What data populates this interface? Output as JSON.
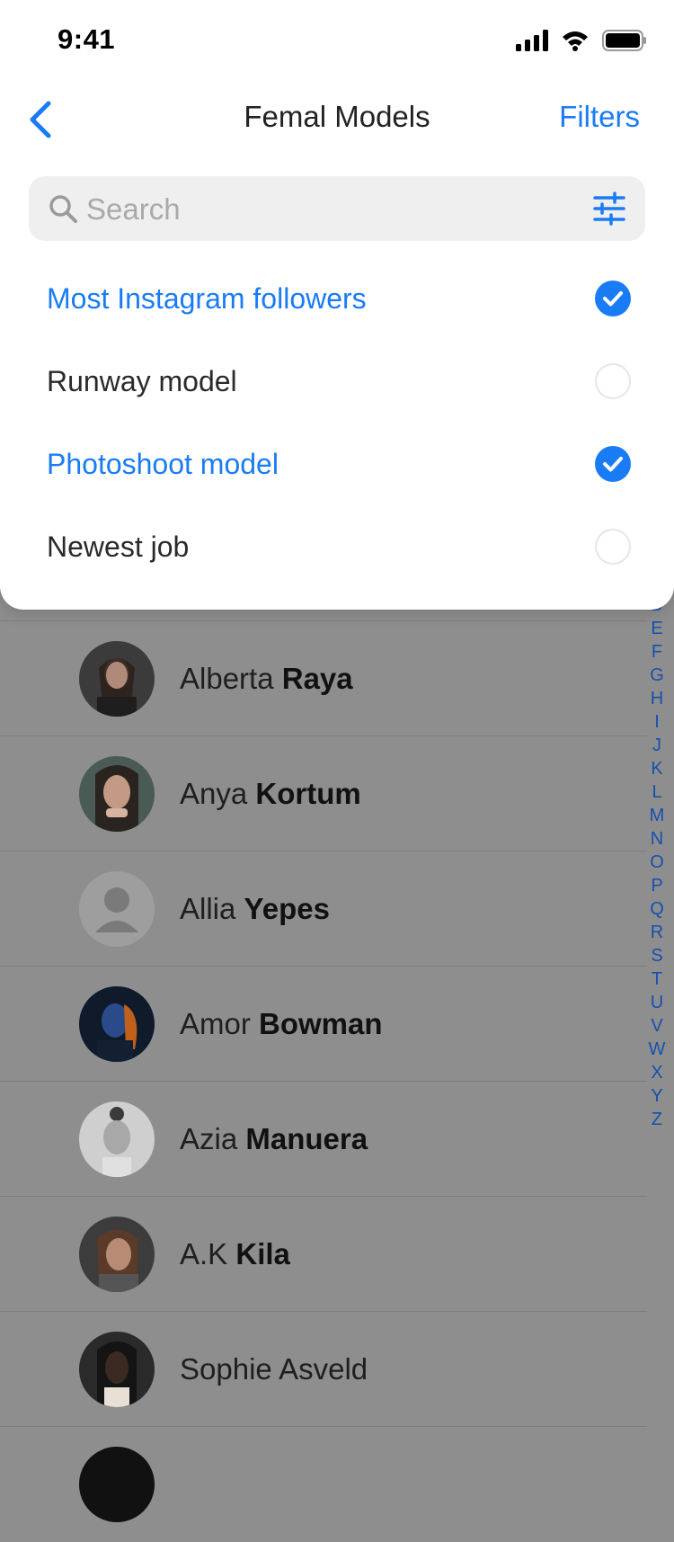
{
  "status": {
    "time": "9:41"
  },
  "nav": {
    "title": "Femal Models",
    "filters_label": "Filters"
  },
  "search": {
    "placeholder": "Search"
  },
  "options": [
    {
      "label": "Most Instagram followers",
      "checked": true
    },
    {
      "label": "Runway model",
      "checked": false
    },
    {
      "label": "Photoshoot model",
      "checked": true
    },
    {
      "label": "Newest job",
      "checked": false
    }
  ],
  "models": [
    {
      "first": "Alberta",
      "last": "Raya"
    },
    {
      "first": "Anya",
      "last": "Kortum"
    },
    {
      "first": "Allia",
      "last": "Yepes"
    },
    {
      "first": "Amor",
      "last": "Bowman"
    },
    {
      "first": "Azia",
      "last": "Manuera"
    },
    {
      "first": "A.K",
      "last": "Kila"
    },
    {
      "first": "Sophie Asveld",
      "last": ""
    }
  ],
  "alphabet": [
    "D",
    "E",
    "F",
    "G",
    "H",
    "I",
    "J",
    "K",
    "L",
    "M",
    "N",
    "O",
    "P",
    "Q",
    "R",
    "S",
    "T",
    "U",
    "V",
    "W",
    "X",
    "Y",
    "Z"
  ],
  "colors": {
    "accent": "#1a7cf5",
    "overlay": "#8e8e8e"
  }
}
